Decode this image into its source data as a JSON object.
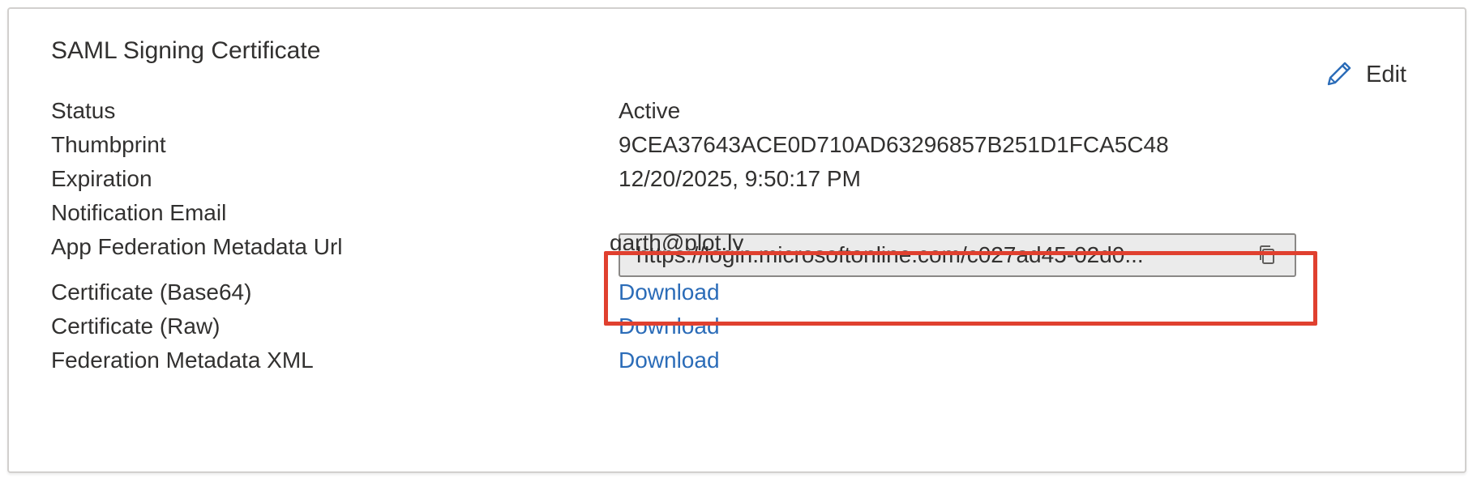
{
  "card": {
    "title": "SAML Signing Certificate",
    "edit_label": "Edit"
  },
  "rows": [
    {
      "label": "Status",
      "value": "Active"
    },
    {
      "label": "Thumbprint",
      "value": "9CEA37643ACE0D710AD63296857B251D1FCA5C48"
    },
    {
      "label": "Expiration",
      "value": "12/20/2025, 9:50:17 PM"
    },
    {
      "label": "Notification Email",
      "value": "garth@plot.ly"
    },
    {
      "label": "App Federation Metadata Url",
      "value": "https://login.microsoftonline.com/c027ad45-02d0..."
    },
    {
      "label": "Certificate (Base64)",
      "value": "Download"
    },
    {
      "label": "Certificate (Raw)",
      "value": "Download"
    },
    {
      "label": "Federation Metadata XML",
      "value": "Download"
    }
  ],
  "icons": {
    "edit": "pencil-icon",
    "copy": "copy-icon"
  },
  "colors": {
    "link": "#2b6cb8",
    "highlight": "#e0402f",
    "text": "#323130"
  }
}
